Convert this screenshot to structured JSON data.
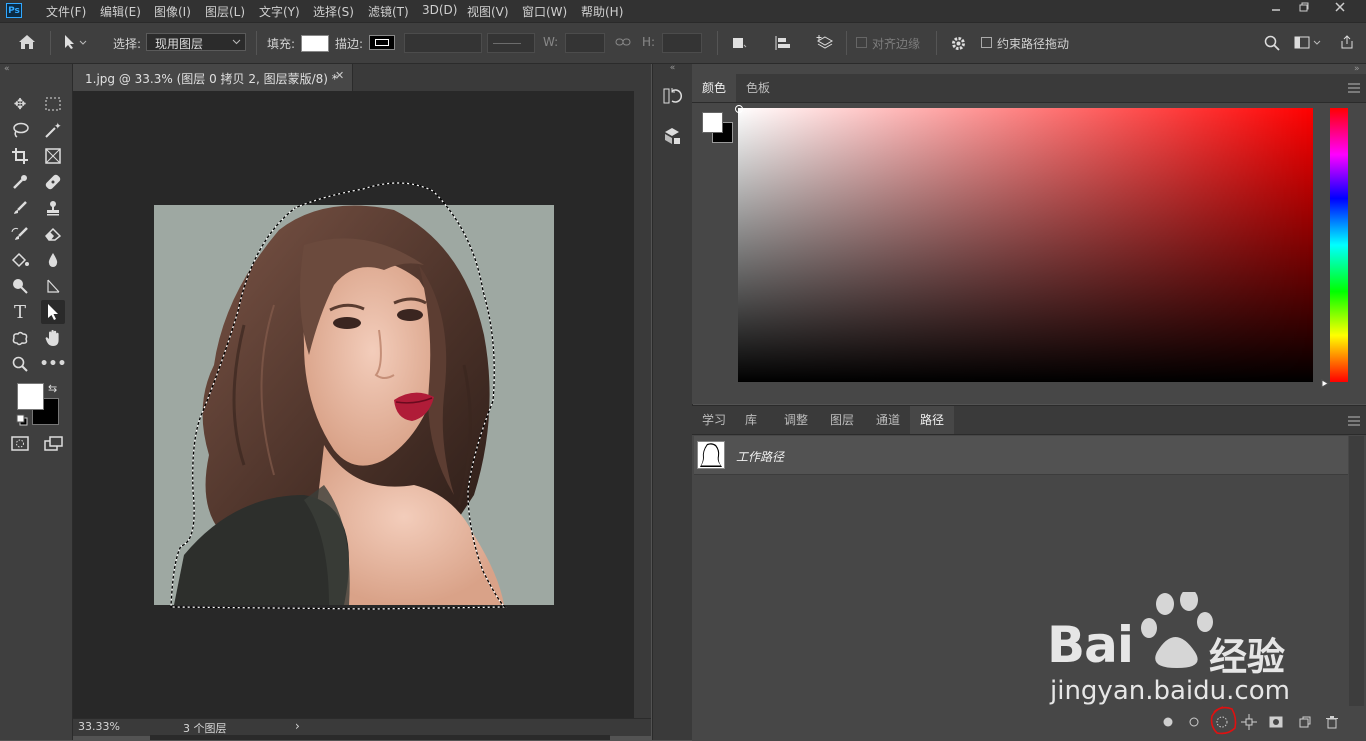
{
  "app": {
    "logo": "Ps"
  },
  "menu": [
    "文件(F)",
    "编辑(E)",
    "图像(I)",
    "图层(L)",
    "文字(Y)",
    "选择(S)",
    "滤镜(T)",
    "3D(D)",
    "视图(V)",
    "窗口(W)",
    "帮助(H)"
  ],
  "options": {
    "select_label": "选择:",
    "select_value": "现用图层",
    "fill_label": "填充:",
    "stroke_label": "描边:",
    "w_label": "W:",
    "h_label": "H:",
    "align_edges": "对齐边缘",
    "constrain_path": "约束路径拖动"
  },
  "document": {
    "tab_title": "1.jpg @ 33.3% (图层 0 拷贝 2, 图层蒙版/8) *",
    "zoom": "33.33%",
    "layers_info": "3 个图层"
  },
  "color_panel": {
    "tabs": [
      "颜色",
      "色板"
    ],
    "active_tab": "颜色"
  },
  "paths_panel": {
    "tabs": [
      "学习",
      "库",
      "调整",
      "图层",
      "通道",
      "路径"
    ],
    "active_tab": "路径",
    "items": [
      {
        "name": "工作路径"
      }
    ]
  },
  "watermark": {
    "brand": "Bai",
    "brand_cn": "经验",
    "url": "jingyan.baidu.com"
  },
  "colors": {
    "accent": "#31a8ff",
    "highlight_ring": "#e01010"
  }
}
